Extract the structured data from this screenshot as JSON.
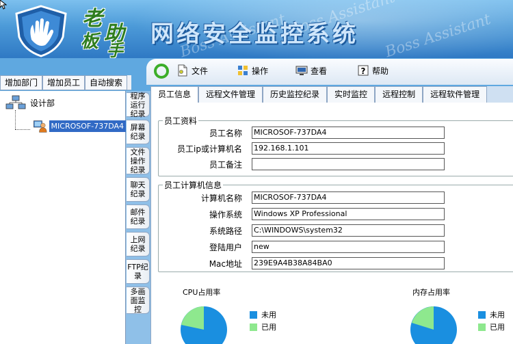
{
  "banner": {
    "logo_chars": [
      "老",
      "板",
      "助",
      "手"
    ],
    "title": "网络安全监控系统",
    "watermark": "Boss Assistant"
  },
  "left_toolbar": [
    "增加部门",
    "增加员工",
    "自动搜索"
  ],
  "tree": {
    "root_label": "设计部",
    "child_label": "MICROSOF-737DA4"
  },
  "side_tabs": [
    "程序运行纪录",
    "屏幕纪录",
    "文件操作纪录",
    "聊天纪录",
    "邮件纪录",
    "上网纪录",
    "FTP纪录",
    "多画面监控"
  ],
  "menu": [
    {
      "label": "文件",
      "icon": "file-icon"
    },
    {
      "label": "操作",
      "icon": "operation-icon"
    },
    {
      "label": "查看",
      "icon": "view-icon"
    },
    {
      "label": "帮助",
      "icon": "help-icon"
    }
  ],
  "main_tabs": [
    "员工信息",
    "远程文件管理",
    "历史监控纪录",
    "实时监控",
    "远程控制",
    "远程软件管理"
  ],
  "employee_info": {
    "legend": "员工资料",
    "fields": [
      {
        "label": "员工名称",
        "value": "MICROSOF-737DA4"
      },
      {
        "label": "员工ip或计算机名",
        "value": "192.168.1.101"
      },
      {
        "label": "员工备注",
        "value": ""
      }
    ]
  },
  "computer_info": {
    "legend": "员工计算机信息",
    "fields": [
      {
        "label": "计算机名称",
        "value": "MICROSOF-737DA4"
      },
      {
        "label": "操作系统",
        "value": "Windows XP Professional"
      },
      {
        "label": "系统路径",
        "value": "C:\\WINDOWS\\system32"
      },
      {
        "label": "登陆用户",
        "value": "new"
      },
      {
        "label": "Mac地址",
        "value": "239E9A4B38A84BA0"
      }
    ]
  },
  "cpu": {
    "title": "CPU占用率",
    "legend": [
      "未用",
      "已用"
    ],
    "colors": {
      "unused": "#1a8fe0",
      "used": "#8ee88e"
    }
  },
  "memory": {
    "title": "内存占用率",
    "legend": [
      "未用",
      "已用"
    ],
    "colors": {
      "unused": "#1a8fe0",
      "used": "#8ee88e"
    }
  },
  "colors": {
    "selected": "#316ac5",
    "banner": "#4c9ad8",
    "side_bg": "#8fc0e8"
  }
}
